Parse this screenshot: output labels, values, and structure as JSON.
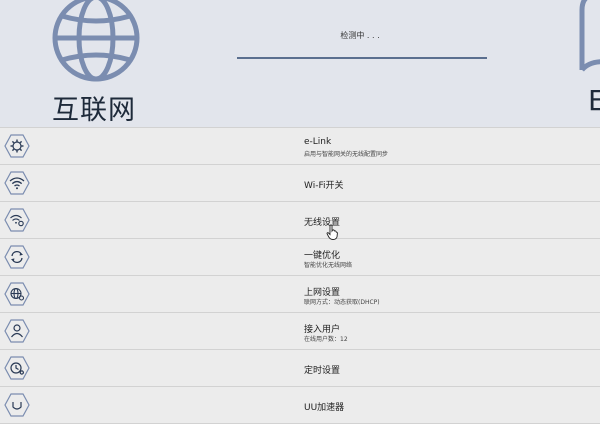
{
  "header": {
    "internet_label": "互联网",
    "status_text": "检测中 . . .",
    "router_label": "E"
  },
  "menu": [
    {
      "title": "e-Link",
      "subtitle": "启用与智能网关的无线配置同步",
      "icon": "elink-gear-icon"
    },
    {
      "title": "Wi-Fi开关",
      "subtitle": "",
      "icon": "wifi-icon"
    },
    {
      "title": "无线设置",
      "subtitle": "",
      "icon": "wireless-settings-icon"
    },
    {
      "title": "一键优化",
      "subtitle": "智能优化无线网络",
      "icon": "refresh-icon"
    },
    {
      "title": "上网设置",
      "subtitle": "联网方式：动态获取(DHCP)",
      "icon": "globe-settings-icon"
    },
    {
      "title": "接入用户",
      "subtitle": "在线用户数：12",
      "icon": "user-icon"
    },
    {
      "title": "定时设置",
      "subtitle": "",
      "icon": "timer-icon"
    },
    {
      "title": "UU加速器",
      "subtitle": "",
      "icon": "accelerator-icon"
    }
  ],
  "colors": {
    "header_bg": "#e2e5ec",
    "accent": "#7b8db0",
    "row_bg": "#ececec"
  }
}
